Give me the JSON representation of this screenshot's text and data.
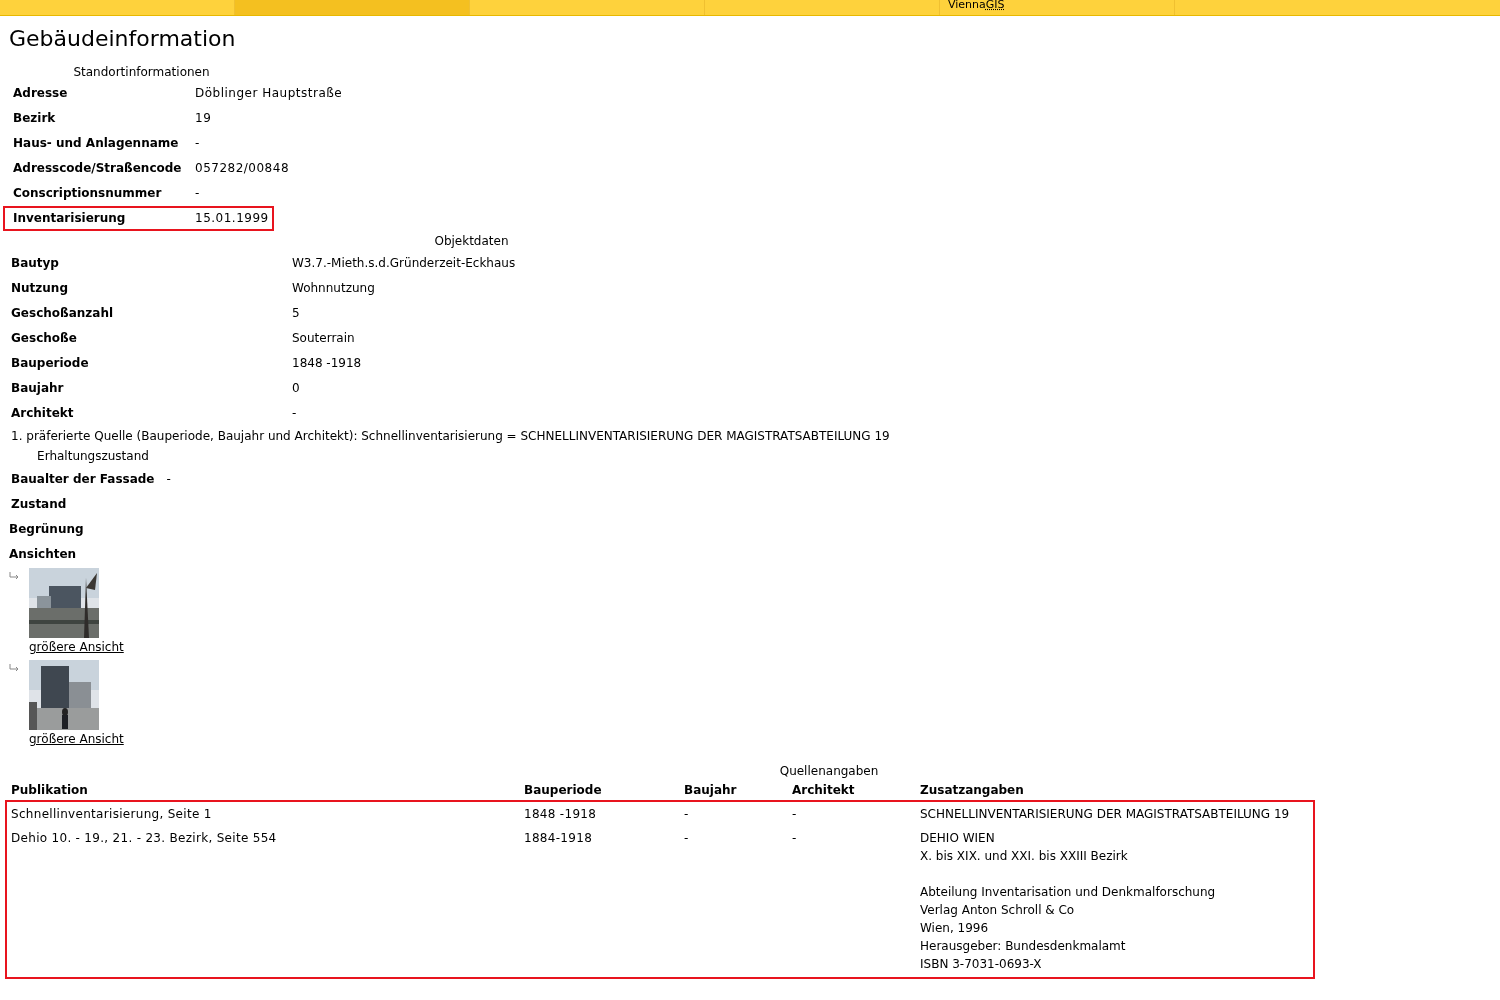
{
  "tabs": [
    {
      "selected": false
    },
    {
      "selected": true
    },
    {
      "selected": false
    },
    {
      "selected": false
    },
    {
      "selected": false,
      "label": "Vienna",
      "abbr": "GIS"
    },
    {
      "selected": false
    }
  ],
  "title": "Gebäudeinformation",
  "location": {
    "caption": "Standortinformationen",
    "rows": [
      {
        "label": "Adresse",
        "value": "Döblinger Hauptstraße",
        "highlighted": false
      },
      {
        "label": "Bezirk",
        "value": "19",
        "highlighted": false
      },
      {
        "label": "Haus- und Anlagenname",
        "value": "-",
        "highlighted": false
      },
      {
        "label": "Adresscode/Straßencode",
        "value": "057282/00848",
        "highlighted": false
      },
      {
        "label": "Conscriptionsnummer",
        "value": "-",
        "highlighted": false
      },
      {
        "label": "Inventarisierung",
        "value": "15.01.1999",
        "highlighted": true
      }
    ]
  },
  "object": {
    "caption": "Objektdaten",
    "rows": [
      {
        "label": "Bautyp",
        "value": "W3.7.-Mieth.s.d.Gründerzeit-Eckhaus"
      },
      {
        "label": "Nutzung",
        "value": "Wohnnutzung"
      },
      {
        "label": "Geschoßanzahl",
        "value": "5"
      },
      {
        "label": "Geschoße",
        "value": "Souterrain"
      },
      {
        "label": "Bauperiode",
        "value": "1848 -1918"
      },
      {
        "label": "Baujahr",
        "value": "0"
      },
      {
        "label": "Architekt",
        "value": "-"
      }
    ],
    "note": "1. präferierte Quelle (Bauperiode, Baujahr und Architekt): Schnellinventarisierung = SCHNELLINVENTARISIERUNG DER MAGISTRATSABTEILUNG 19"
  },
  "condition": {
    "caption": "Erhaltungszustand",
    "rows": [
      {
        "label": "Baualter der Fassade",
        "value": "-"
      },
      {
        "label": "Zustand"
      }
    ]
  },
  "greening": {
    "label": "Begrünung"
  },
  "views": {
    "heading": "Ansichten",
    "items": [
      {
        "link": "größere Ansicht"
      },
      {
        "link": "größere Ansicht"
      }
    ]
  },
  "sources": {
    "caption": "Quellenangaben",
    "highlighted": true,
    "columns": [
      "Publikation",
      "Bauperiode",
      "Baujahr",
      "Architekt",
      "Zusatzangaben"
    ],
    "rows": [
      {
        "cells": [
          "Schnellinventarisierung, Seite 1",
          "1848 -1918",
          "-",
          "-"
        ],
        "extra": [
          [
            "SCHNELLINVENTARISIERUNG DER MAGISTRATSABTEILUNG 19"
          ]
        ]
      },
      {
        "cells": [
          "Dehio 10. - 19., 21. - 23. Bezirk, Seite 554",
          "1884-1918",
          "-",
          "-"
        ],
        "extra": [
          [
            "DEHIO WIEN",
            "X. bis XIX. und XXI. bis XXIII Bezirk"
          ],
          [
            "Abteilung Inventarisation und Denkmalforschung",
            "Verlag Anton Schroll & Co",
            "Wien, 1996",
            "Herausgeber: Bundesdenkmalamt",
            "ISBN 3-7031-0693-X"
          ]
        ]
      }
    ]
  }
}
